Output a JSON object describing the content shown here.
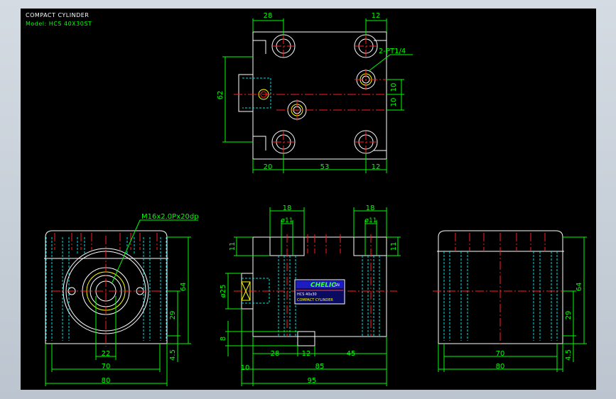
{
  "title_block": {
    "title": "COMPACT CYLINDER",
    "model": "Model: HCS 40X30ST"
  },
  "top_view": {
    "dims": {
      "top_left": "28",
      "top_right": "12",
      "height": "62",
      "port_a": "10",
      "port_b": "10",
      "bottom_left": "20",
      "bottom_mid": "53",
      "bottom_right": "12"
    },
    "port_label": "2-PT1/4"
  },
  "left_view": {
    "thread_label": "M16x2.0Px20dp",
    "dims": {
      "bore": "22",
      "inner": "70",
      "width": "80",
      "height": "64",
      "center": "29",
      "base": "4.5"
    }
  },
  "front_view": {
    "dims": {
      "hole1_w": "18",
      "hole2_w": "18",
      "hole1_dia": "ø11",
      "hole2_dia": "ø11",
      "depth_left": "11",
      "depth_right": "11",
      "rod_dia": "ø25",
      "rod_offset": "8",
      "b_28": "28",
      "b_12": "12",
      "b_45": "45",
      "b_10": "10",
      "b_85": "85",
      "b_95": "95"
    },
    "nameplate": {
      "brand": "CHELIC",
      "badge": "SN",
      "model": "HCS 40x30",
      "product": "COMPACT CYLINDER"
    }
  },
  "right_view": {
    "dims": {
      "inner": "70",
      "width": "80",
      "height": "64",
      "center": "29",
      "base": "4.5"
    }
  },
  "colors": {
    "outline": "#ffffff",
    "dimension": "#00ff00",
    "centerline": "#ff2020",
    "hidden": "#00e0e0",
    "hatch": "#ffff00",
    "background": "#000000"
  }
}
